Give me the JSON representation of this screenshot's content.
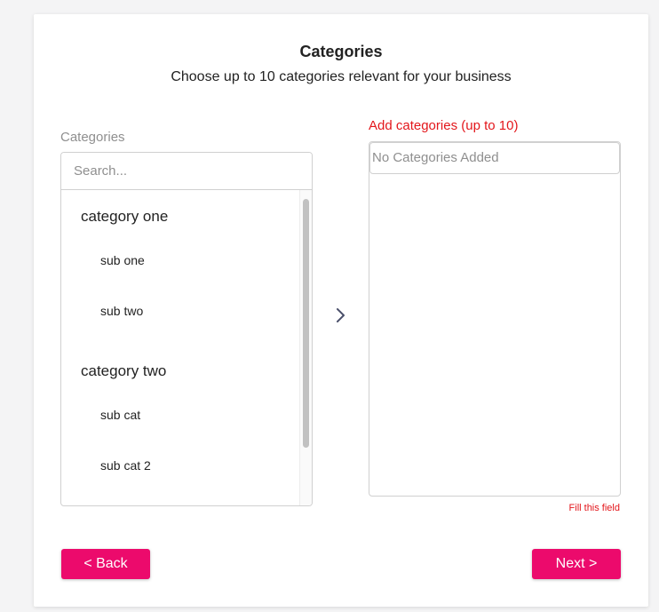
{
  "header": {
    "title": "Categories",
    "subtitle": "Choose up to 10 categories relevant for your business"
  },
  "available": {
    "label": "Categories",
    "search_placeholder": "Search...",
    "groups": [
      {
        "name": "category one",
        "subs": [
          "sub one",
          "sub two"
        ]
      },
      {
        "name": "category two",
        "subs": [
          "sub cat",
          "sub cat 2"
        ]
      }
    ]
  },
  "selected": {
    "label": "Add categories (up to 10)",
    "empty_text": "No Categories Added",
    "error": "Fill this field"
  },
  "actions": {
    "back_label": "< Back",
    "next_label": "Next >"
  },
  "icons": {
    "move": "chevron-right-icon"
  },
  "colors": {
    "accent": "#ec0a6c",
    "error": "#e3161b"
  }
}
